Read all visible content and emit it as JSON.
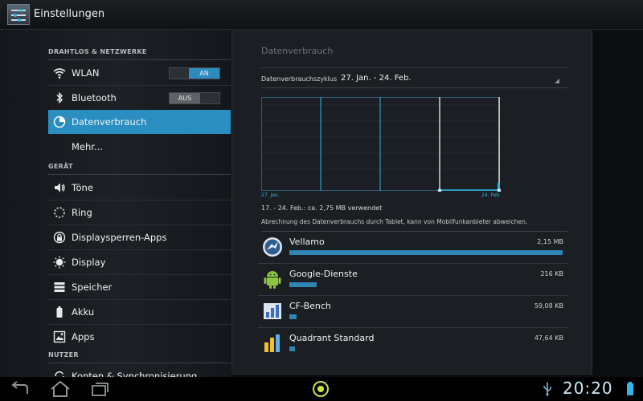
{
  "actionbar": {
    "title": "Einstellungen"
  },
  "sidebar": {
    "sections": [
      {
        "label": "DRAHTLOS & NETZWERKE"
      },
      {
        "label": "GERÄT"
      },
      {
        "label": "NUTZER"
      }
    ],
    "items": [
      {
        "label": "WLAN",
        "icon": "wifi-icon",
        "toggle": "AN",
        "toggle_state": "on"
      },
      {
        "label": "Bluetooth",
        "icon": "bluetooth-icon",
        "toggle": "AUS",
        "toggle_state": "off"
      },
      {
        "label": "Datenverbrauch",
        "icon": "data-usage-icon",
        "active": true
      },
      {
        "label": "Mehr..."
      },
      {
        "label": "Töne",
        "icon": "speaker-icon"
      },
      {
        "label": "Ring",
        "icon": "ring-icon"
      },
      {
        "label": "Displaysperren-Apps",
        "icon": "lock-screen-icon"
      },
      {
        "label": "Display",
        "icon": "brightness-icon"
      },
      {
        "label": "Speicher",
        "icon": "storage-icon"
      },
      {
        "label": "Akku",
        "icon": "battery-icon"
      },
      {
        "label": "Apps",
        "icon": "apps-icon"
      },
      {
        "label": "Konten & Synchronisierung",
        "icon": "sync-icon"
      }
    ]
  },
  "panel": {
    "title": "Datenverbrauch",
    "cycle_label": "Datenverbrauchszyklus",
    "cycle_value": "27. Jan. - 24. Feb.",
    "chart_start_label": "27. Jan.",
    "chart_end_label": "24. Feb.",
    "usage_caption": "17. - 24. Feb.: ca. 2,75 MB verwendet",
    "usage_note": "Abrechnung des Datenverbrauchs durch Tablet, kann von Mobilfunkanbieter abweichen.",
    "apps": [
      {
        "name": "Vellamo",
        "size": "2,15 MB",
        "fraction": 1.0,
        "icon": "vellamo-icon"
      },
      {
        "name": "Google-Dienste",
        "size": "216 KB",
        "fraction": 0.1,
        "icon": "android-icon"
      },
      {
        "name": "CF-Bench",
        "size": "59,08 KB",
        "fraction": 0.027,
        "icon": "cf-bench-icon"
      },
      {
        "name": "Quadrant Standard",
        "size": "47,64 KB",
        "fraction": 0.022,
        "icon": "quadrant-icon"
      }
    ]
  },
  "navbar": {
    "clock": "20:20"
  },
  "colors": {
    "accent": "#33b5e5",
    "active_bg": "#2a8fc0",
    "bar": "#2f86b5"
  }
}
